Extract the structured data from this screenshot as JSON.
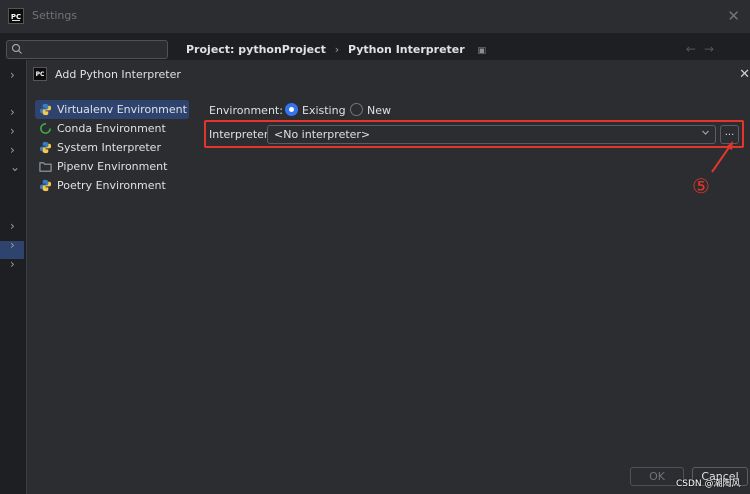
{
  "settings": {
    "logo_text": "PC",
    "title": "Settings",
    "close_symbol": "✕",
    "search_icon": "search-icon"
  },
  "breadcrumb": {
    "items": [
      "Project: pythonProject",
      "Python Interpreter"
    ],
    "separator": "›",
    "nav_back": "←",
    "nav_forward": "→"
  },
  "tree_chevrons": [
    {
      "symbol": "›"
    },
    {
      "symbol": "›"
    },
    {
      "symbol": "›"
    },
    {
      "symbol": "›"
    },
    {
      "symbol": "⌄"
    },
    {
      "symbol": "›"
    },
    {
      "symbol": "›"
    },
    {
      "symbol": "›"
    }
  ],
  "dialog": {
    "logo_text": "PC",
    "title": "Add Python Interpreter",
    "close_symbol": "✕",
    "types": [
      {
        "label": "Virtualenv Environment",
        "icon": "python-icon",
        "selected": true
      },
      {
        "label": "Conda Environment",
        "icon": "conda-icon",
        "selected": false
      },
      {
        "label": "System Interpreter",
        "icon": "python-icon",
        "selected": false
      },
      {
        "label": "Pipenv Environment",
        "icon": "folder-icon",
        "selected": false
      },
      {
        "label": "Poetry Environment",
        "icon": "python-icon",
        "selected": false
      }
    ],
    "environment_label": "Environment:",
    "environment_options": [
      {
        "label": "Existing",
        "checked": true
      },
      {
        "label": "New",
        "checked": false
      }
    ],
    "interpreter_label": "Interpreter:",
    "interpreter_value": "<No interpreter>",
    "browse_label": "...",
    "ok_label": "OK",
    "cancel_label": "Cancel"
  },
  "annotation": {
    "step": "⑤",
    "color": "#e5342c"
  },
  "watermark": "CSDN @潮陶风"
}
